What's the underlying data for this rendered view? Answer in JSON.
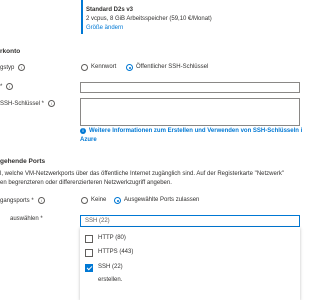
{
  "size": {
    "title": "Standard D2s v3",
    "specs": "2 vcpus, 8 GiB Arbeitsspeicher (59,10 €/Monat)",
    "change_link": "Größe ändern"
  },
  "admin": {
    "section_title": "rkonto",
    "auth_type_label": "gstyp",
    "auth_options": [
      "Kennwort",
      "Öffentlicher SSH-Schlüssel"
    ],
    "auth_selected": "Öffentlicher SSH-Schlüssel",
    "username_label": "*",
    "ssh_key_label": "SSH-Schlüssel *",
    "ssh_info_line1": "Weitere Informationen zum Erstellen und Verwenden von SSH-Schlüsseln i",
    "ssh_info_line2": "Azure"
  },
  "ports": {
    "section_title": "gehende Ports",
    "desc_line1": "l, welche VM-Netzwerkports über das öffentliche Internet zugänglich sind. Auf der Registerkarte \"Netzwerk\"",
    "desc_line2": "en begrenzteren oder differenzierteren Netzwerkzugriff angeben.",
    "public_ports_label": "gangsports *",
    "public_ports_options": [
      "Keine",
      "Ausgewählte Ports zulassen"
    ],
    "public_ports_selected": "Ausgewählte Ports zulassen",
    "select_label": "auswählen *",
    "select_value": "SSH (22)",
    "options": [
      {
        "label": "HTTP (80)",
        "checked": false
      },
      {
        "label": "HTTPS (443)",
        "checked": false
      },
      {
        "label": "SSH (22)",
        "checked": true
      }
    ],
    "bottom_text": "erstellen."
  },
  "colors": {
    "accent": "#0078d4",
    "text": "#323130"
  }
}
